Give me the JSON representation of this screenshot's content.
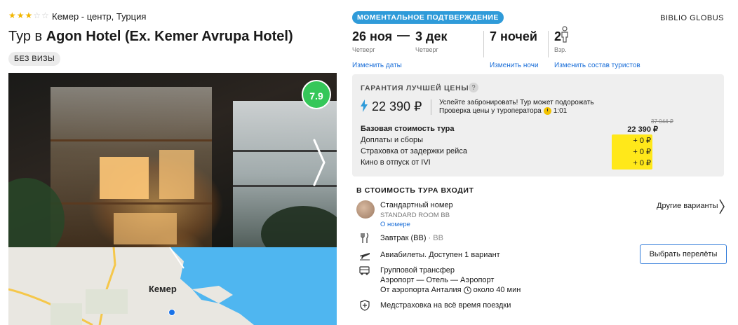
{
  "hotel": {
    "stars": 3,
    "max_stars": 5,
    "location": "Кемер - центр, Турция",
    "title_prefix": "Тур в ",
    "name": "Agon Hotel (Ex. Kemer Avrupa Hotel)",
    "visa_badge": "БЕЗ ВИЗЫ",
    "rating": "7.9"
  },
  "map": {
    "city_label": "Кемер"
  },
  "booking": {
    "instant_badge": "МОМЕНТАЛЬНОЕ ПОДТВЕРЖДЕНИЕ",
    "operator": "BIBLIO GLOBUS",
    "date_from": "26 ноя",
    "date_from_day": "Четверг",
    "date_sep": "—",
    "date_to": "3 дек",
    "date_to_day": "Четверг",
    "nights": "7 ночей",
    "tourists": "2",
    "tourists_label": "Взр.",
    "change_dates": "Изменить даты",
    "change_nights": "Изменить ночи",
    "change_tourists": "Изменить состав туристов"
  },
  "price": {
    "guarantee": "ГАРАНТИЯ ЛУЧШЕЙ ЦЕНЫ",
    "help": "?",
    "total": "22 390 ₽",
    "hint_line1": "Успейте забронировать! Тур может подорожать",
    "hint_line2": "Проверка цены у туроператора",
    "hint_time": "1:01",
    "old_price": "37 044 ₽",
    "rows": [
      {
        "label": "Базовая стоимость тура",
        "value": "22 390 ₽"
      },
      {
        "label": "Доплаты и сборы",
        "value": "+ 0 ₽"
      },
      {
        "label": "Страховка от задержки рейса",
        "value": "+ 0 ₽"
      },
      {
        "label": "Кино в отпуск от IVI",
        "value": "+ 0 ₽"
      }
    ]
  },
  "includes": {
    "title": "В СТОИМОСТЬ ТУРА ВХОДИТ",
    "room_name": "Стандартный номер",
    "room_code": "STANDARD ROOM BB",
    "room_link": "О номере",
    "other_variants": "Другие варианты",
    "meal": "Завтрак (BB)",
    "meal_code": "· BB",
    "flights": "Авиабилеты. Доступен 1 вариант",
    "select_flights": "Выбрать перелёты",
    "transfer_title": "Групповой трансфер",
    "transfer_route": "Аэропорт — Отель — Аэропорт",
    "transfer_from": "От аэропорта Анталия",
    "transfer_time": "около 40 мин",
    "insurance": "Медстраховка на всё время поездки"
  },
  "colors": {
    "accent_blue": "#2f9bd9",
    "link": "#1a6ed8",
    "rating_green": "#35c759",
    "highlight_yellow": "#ffe81a"
  }
}
